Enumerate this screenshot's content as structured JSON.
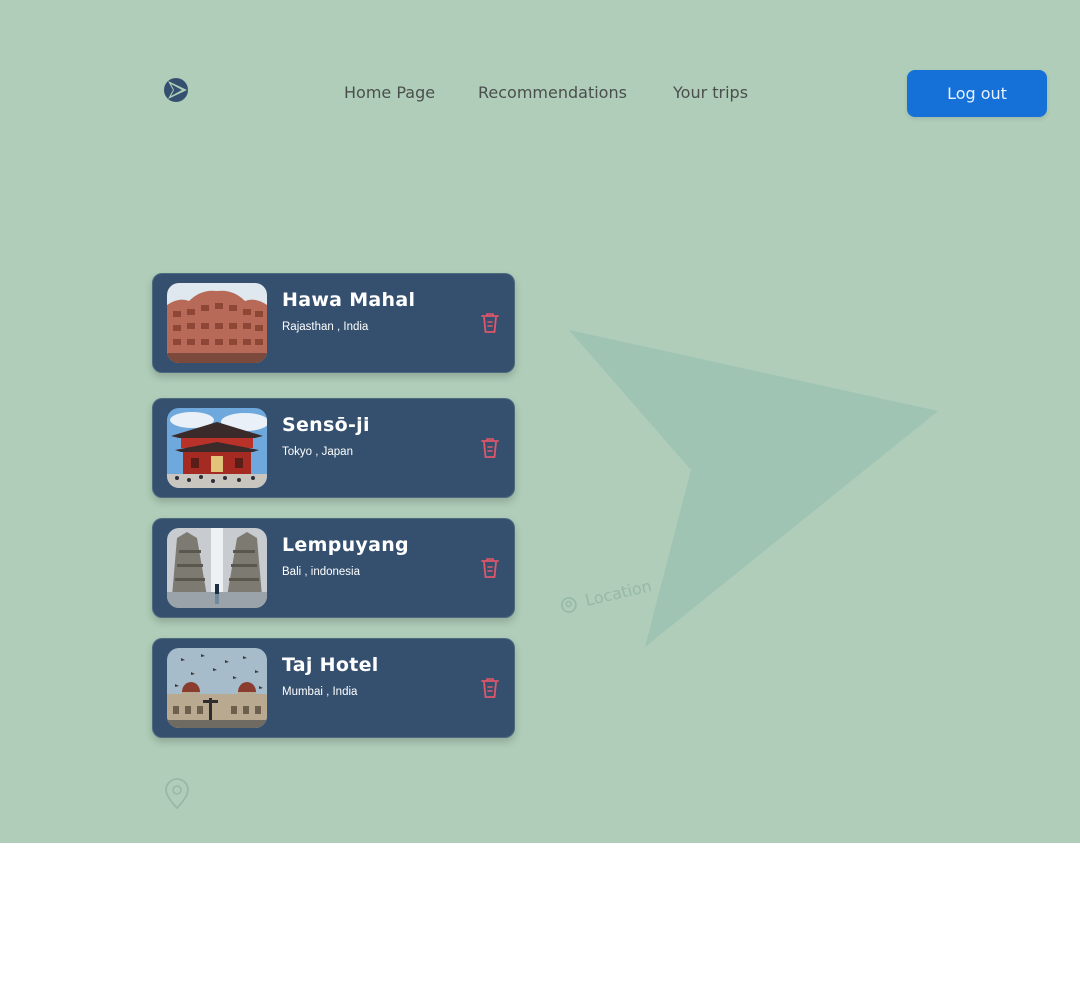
{
  "nav": {
    "logo_icon": "play-arrow-logo-icon",
    "links": [
      "Home Page",
      "Recommendations",
      "Your trips"
    ],
    "logout_label": "Log out"
  },
  "background": {
    "location_label": "Location"
  },
  "trips": [
    {
      "title": "Hawa Mahal",
      "subtitle": "Rajasthan , India"
    },
    {
      "title": "Sensō-ji",
      "subtitle": "Tokyo , Japan"
    },
    {
      "title": "Lempuyang",
      "subtitle": "Bali , indonesia"
    },
    {
      "title": "Taj Hotel",
      "subtitle": "Mumbai , India"
    }
  ],
  "colors": {
    "background": "#afcdb9",
    "card": "#35506f",
    "button": "#1570d8",
    "trash": "#e0566a"
  }
}
